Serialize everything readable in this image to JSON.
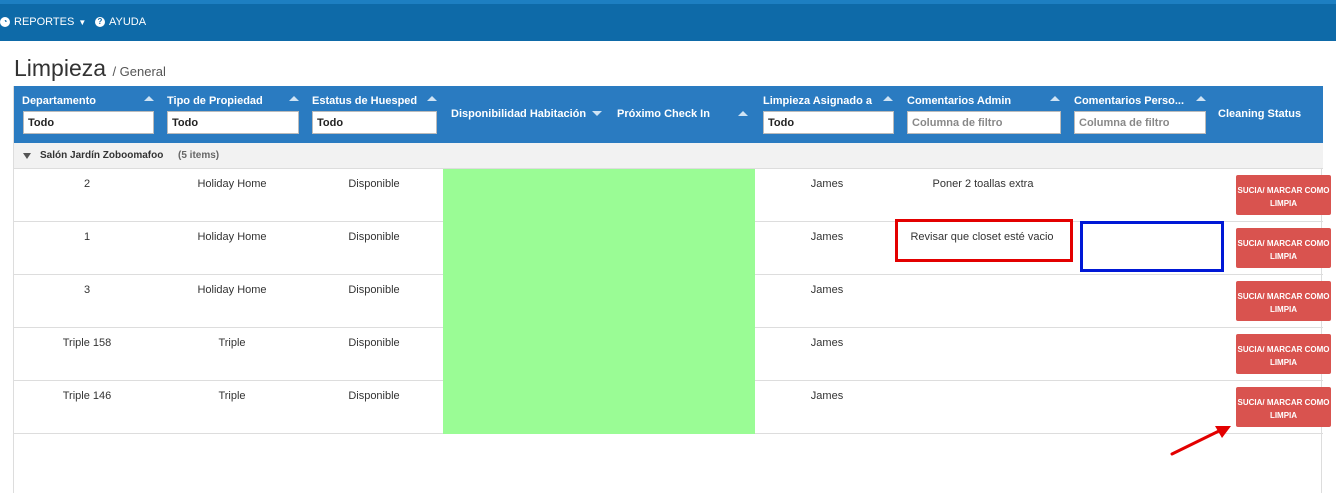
{
  "nav": {
    "reportes": "REPORTES",
    "ayuda": "AYUDA"
  },
  "page": {
    "title": "Limpieza",
    "subtitle": "/ General"
  },
  "columns": {
    "departamento": "Departamento",
    "tipo": "Tipo de Propiedad",
    "estatus": "Estatus de Huesped",
    "disponibilidad": "Disponibilidad Habitación",
    "checkin": "Próximo Check In",
    "asignado": "Limpieza Asignado a",
    "com_admin": "Comentarios Admin",
    "com_personal": "Comentarios Perso...",
    "cleaning": "Cleaning Status"
  },
  "filters": {
    "departamento": "Todo",
    "tipo": "Todo",
    "estatus": "Todo",
    "asignado": "Todo",
    "com_admin_placeholder": "Columna de filtro",
    "com_personal_placeholder": "Columna de filtro"
  },
  "group": {
    "name": "Salón Jardín Zoboomafoo",
    "count": "(5 items)"
  },
  "rows": [
    {
      "dept": "2",
      "tipo": "Holiday Home",
      "estatus": "Disponible",
      "asignado": "James",
      "com_admin": "Poner 2 toallas extra",
      "button": "SUCIA/ MARCAR COMO LIMPIA"
    },
    {
      "dept": "1",
      "tipo": "Holiday Home",
      "estatus": "Disponible",
      "asignado": "James",
      "com_admin": "Revisar que closet esté vacio",
      "button": "SUCIA/ MARCAR COMO LIMPIA"
    },
    {
      "dept": "3",
      "tipo": "Holiday Home",
      "estatus": "Disponible",
      "asignado": "James",
      "com_admin": "",
      "button": "SUCIA/ MARCAR COMO LIMPIA"
    },
    {
      "dept": "Triple 158",
      "tipo": "Triple",
      "estatus": "Disponible",
      "asignado": "James",
      "com_admin": "",
      "button": "SUCIA/ MARCAR COMO LIMPIA"
    },
    {
      "dept": "Triple 146",
      "tipo": "Triple",
      "estatus": "Disponible",
      "asignado": "James",
      "com_admin": "",
      "button": "SUCIA/ MARCAR COMO LIMPIA"
    }
  ],
  "colors": {
    "header_bg": "#2a7bc1",
    "topbar_bg": "#0e6aa8",
    "available_green": "#9afc95",
    "button_red": "#d9534f"
  }
}
